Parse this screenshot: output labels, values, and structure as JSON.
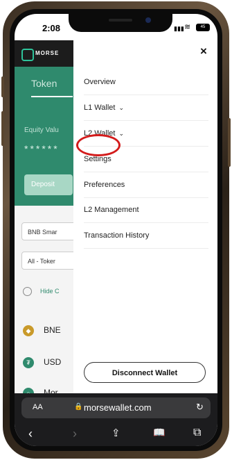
{
  "status": {
    "time": "2:08",
    "signal": "▮▮▮",
    "wifi": "≋",
    "battery": "45"
  },
  "app": {
    "brand": "MORSE",
    "token_tab": "Token",
    "equity_label": "Equity Valu",
    "equity_masked": "******",
    "deposit_label": "Deposit",
    "chain_select": "BNB Smar",
    "token_filter": "All - Toker",
    "hide_label": "Hide C",
    "tokens": [
      {
        "symbol": "BNE",
        "icon": "bnb-icon",
        "color": "#c99a2a"
      },
      {
        "symbol": "USD",
        "icon": "tether-icon",
        "color": "#2f8a6d"
      },
      {
        "symbol": "Mor",
        "icon": "morse-icon",
        "color": "#2f8a6d"
      }
    ]
  },
  "drawer": {
    "close_icon": "×",
    "items": [
      {
        "label": "Overview",
        "has_chevron": false
      },
      {
        "label": "L1 Wallet",
        "has_chevron": true
      },
      {
        "label": "L2 Wallet",
        "has_chevron": true
      },
      {
        "label": "Settings",
        "has_chevron": false
      },
      {
        "label": "Preferences",
        "has_chevron": false
      },
      {
        "label": "L2 Management",
        "has_chevron": false
      },
      {
        "label": "Transaction History",
        "has_chevron": false
      }
    ],
    "chevron": "⌄",
    "disconnect_label": "Disconnect Wallet",
    "highlight_color": "#d31b1b"
  },
  "browser": {
    "text_size": "AA",
    "lock": "🔒",
    "url": "morsewallet.com",
    "reload": "↻",
    "nav": {
      "back": "‹",
      "forward": "›",
      "share": "⇪",
      "bookmarks": "📖",
      "tabs": "⧉"
    }
  }
}
